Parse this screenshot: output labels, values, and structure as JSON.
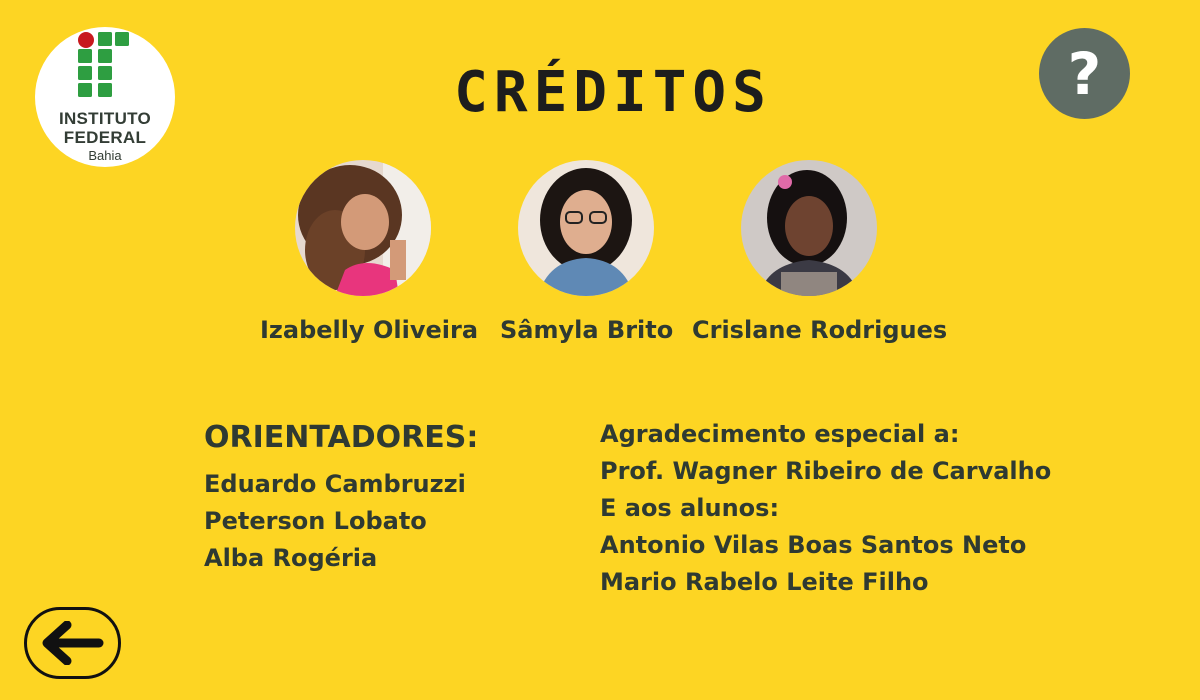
{
  "header": {
    "title": "CRÉDITOS",
    "help_label": "?",
    "help_icon": "question-mark-icon"
  },
  "logo": {
    "line1": "INSTITUTO",
    "line2": "FEDERAL",
    "line3": "Bahia",
    "green": "#2e9e41",
    "red": "#c8191e"
  },
  "team": [
    {
      "name": "Izabelly Oliveira"
    },
    {
      "name": "Sâmyla Brito"
    },
    {
      "name": "Crislane Rodrigues"
    }
  ],
  "advisors": {
    "heading": "ORIENTADORES:",
    "names": [
      "Eduardo Cambruzzi",
      "Peterson Lobato",
      "Alba Rogéria"
    ]
  },
  "acknowledgements": {
    "heading": "Agradecimento especial a:",
    "teacher": "Prof. Wagner Ribeiro de Carvalho",
    "students_heading": "E aos alunos:",
    "students": [
      "Antonio Vilas Boas Santos Neto",
      "Mario Rabelo Leite Filho"
    ]
  },
  "navigation": {
    "back_icon": "arrow-left-icon"
  },
  "colors": {
    "background": "#fdd523",
    "text": "#2f3a32",
    "help_button": "#5f6c64"
  }
}
